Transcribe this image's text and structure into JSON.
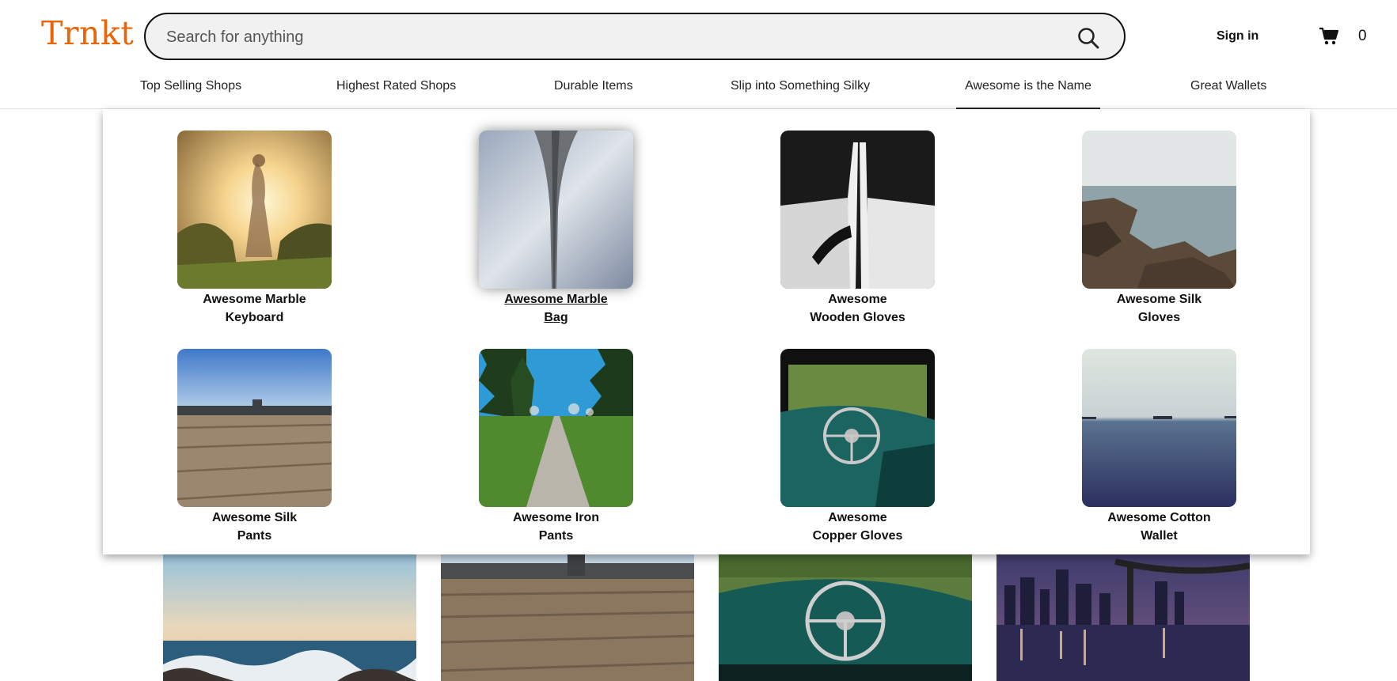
{
  "header": {
    "logo": "Trnkt",
    "search_placeholder": "Search for anything",
    "search_icon": "search-icon",
    "signin_label": "Sign in",
    "cart_icon": "cart-icon",
    "cart_count": "0"
  },
  "nav": {
    "items": [
      {
        "label": "Top Selling Shops"
      },
      {
        "label": "Highest Rated Shops"
      },
      {
        "label": "Durable Items"
      },
      {
        "label": "Slip into Something Silky"
      },
      {
        "label": "Awesome is the Name",
        "active": true
      },
      {
        "label": "Great Wallets"
      }
    ]
  },
  "dropdown": {
    "products": [
      {
        "line1": "Awesome Marble",
        "line2": "Keyboard",
        "image": "girl-in-sunlit-field"
      },
      {
        "line1": "Awesome Marble",
        "line2": "Bag",
        "image": "abstract-architecture-grey",
        "hovered": true
      },
      {
        "line1": "Awesome",
        "line2": "Wooden Gloves",
        "image": "black-white-architecture"
      },
      {
        "line1": "Awesome Silk",
        "line2": "Gloves",
        "image": "rocky-shore"
      },
      {
        "line1": "Awesome Silk",
        "line2": "Pants",
        "image": "wooden-dock-blue-sky"
      },
      {
        "line1": "Awesome Iron",
        "line2": "Pants",
        "image": "path-through-trees"
      },
      {
        "line1": "Awesome",
        "line2": "Copper Gloves",
        "image": "old-car-dashboard"
      },
      {
        "line1": "Awesome Cotton",
        "line2": "Wallet",
        "image": "calm-sea-ships"
      }
    ]
  },
  "background_row": {
    "images": [
      "ocean-waves-sunset",
      "wooden-dock-blurred",
      "old-car-dashboard",
      "city-bridge-night"
    ]
  }
}
